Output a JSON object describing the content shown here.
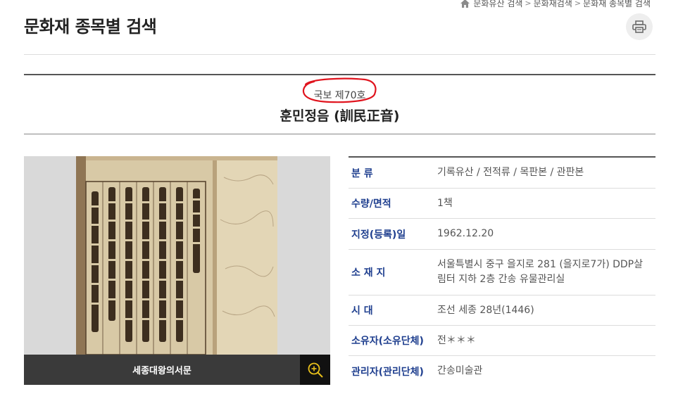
{
  "breadcrumb": {
    "items": [
      "문화유산 검색",
      "문화재검색",
      "문화재 종목별 검색"
    ]
  },
  "page": {
    "title": "문화재 종목별 검색"
  },
  "heritage": {
    "designation": "국보 제70호",
    "name": "훈민정음 (訓民正音)"
  },
  "image": {
    "caption": "세종대왕의서문"
  },
  "info": [
    {
      "label": "분 류",
      "value": "기록유산 / 전적류 / 목판본 / 관판본"
    },
    {
      "label": "수량/면적",
      "value": "1책"
    },
    {
      "label": "지정(등록)일",
      "value": "1962.12.20"
    },
    {
      "label": "소 재 지",
      "value": "서울특별시 중구 을지로 281 (을지로7가) DDP살림터 지하 2층 간송 유물관리실"
    },
    {
      "label": "시 대",
      "value": "조선 세종 28년(1446)"
    },
    {
      "label": "소유자(소유단체)",
      "value": "전＊＊＊"
    },
    {
      "label": "관리자(관리단체)",
      "value": "간송미술관"
    }
  ],
  "colors": {
    "label_blue": "#1f3f8f",
    "annotation_red": "#e0141e",
    "caption_bg": "#2d2d2d"
  }
}
